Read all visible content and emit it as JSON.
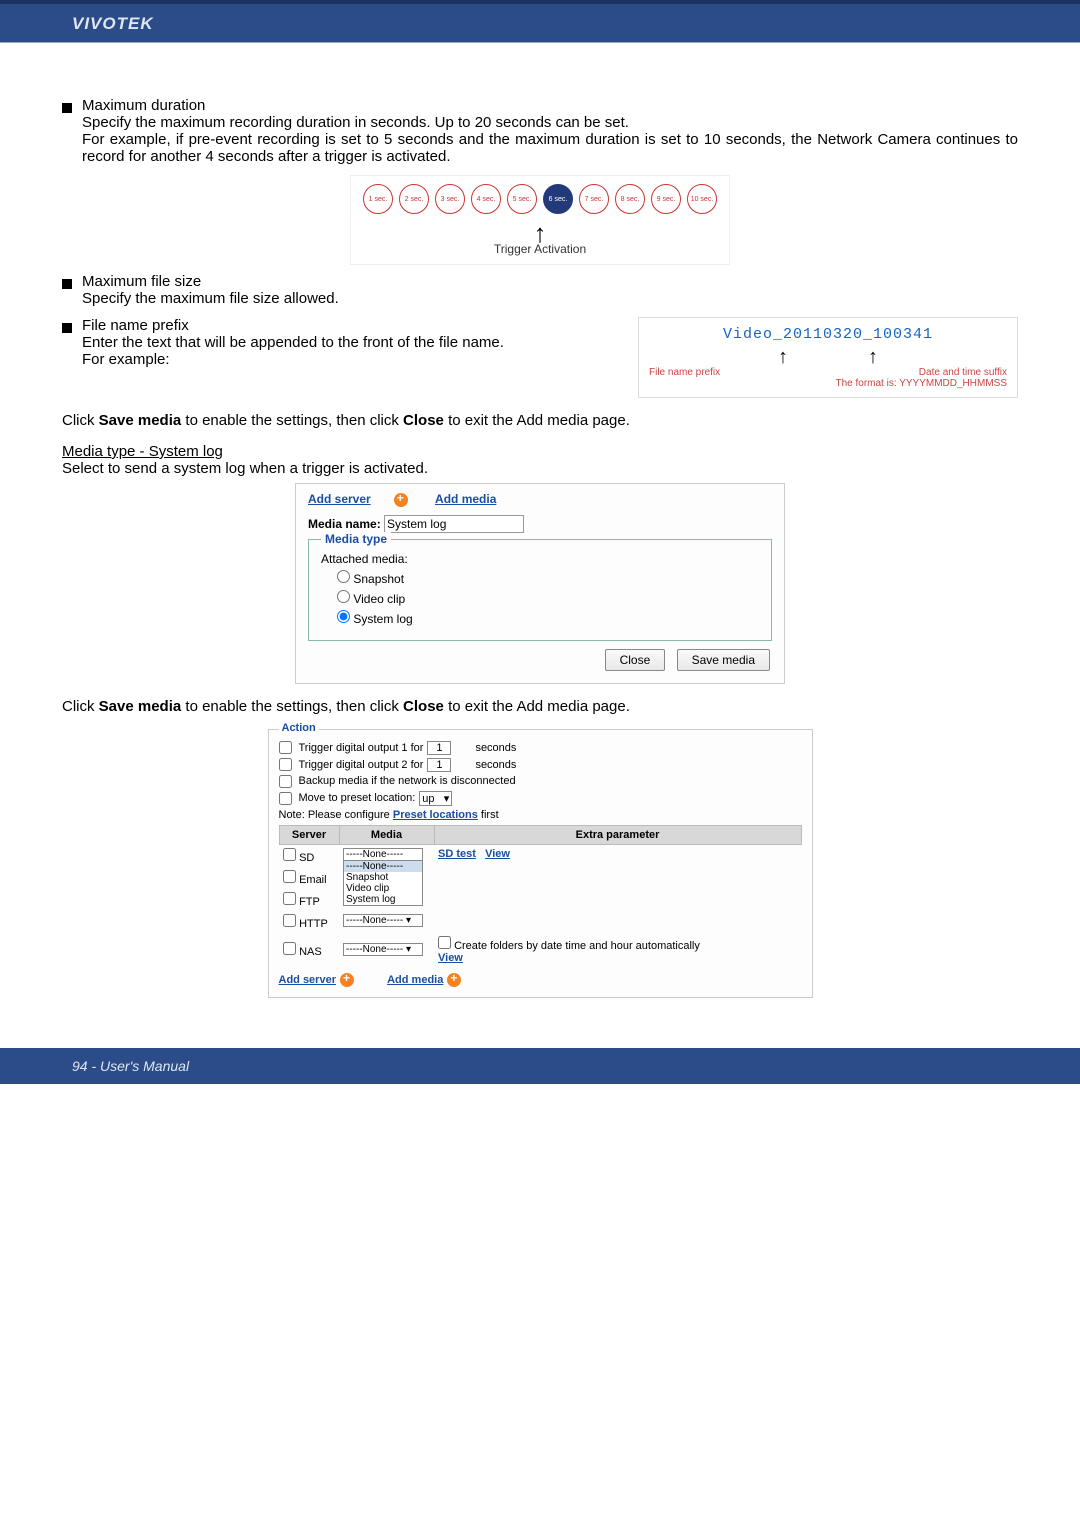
{
  "header": {
    "brand": "VIVOTEK"
  },
  "s1": {
    "title": "Maximum duration",
    "body": "Specify the maximum recording duration in seconds. Up to 20 seconds can be set.",
    "body2": "For example, if pre-event recording is set to 5 seconds and the maximum duration is set to 10 seconds, the Network Camera continues to record for another 4 seconds after a trigger is activated."
  },
  "trigger": {
    "secs": [
      "1 sec.",
      "2 sec.",
      "3 sec.",
      "4 sec.",
      "5 sec.",
      "6 sec.",
      "7 sec.",
      "8 sec.",
      "9 sec.",
      "10 sec."
    ],
    "active_index": 5,
    "label": "Trigger Activation"
  },
  "s2": {
    "title": "Maximum file size",
    "body": "Specify the maximum file size allowed."
  },
  "s3": {
    "title": "File name prefix",
    "body": "Enter the text that will be appended to the front of the file name.",
    "body2": " For example:"
  },
  "prefix": {
    "filename": "Video_20110320_100341",
    "left_label": "File name prefix",
    "right_label": "Date and time suffix",
    "format": "The format is: YYYYMMDD_HHMMSS"
  },
  "para1_a": "Click ",
  "para1_b": "Save media",
  "para1_c": " to enable the settings, then click ",
  "para1_d": "Close",
  "para1_e": " to exit the Add media page.",
  "media_heading": "Media type - System log",
  "media_sub": "Select to send a system log when a trigger is activated.",
  "media_panel": {
    "tab1": "Add server",
    "tab2": "Add media",
    "label": "Media name:",
    "value": "System log",
    "legend": "Media type",
    "attached": "Attached media:",
    "r1": "Snapshot",
    "r2": "Video clip",
    "r3": "System log",
    "close": "Close",
    "save": "Save media"
  },
  "para2_a": "Click ",
  "para2_b": "Save media",
  "para2_c": " to enable the settings, then click ",
  "para2_d": "Close",
  "para2_e": " to exit the Add media page.",
  "action": {
    "legend": "Action",
    "do1_label": "Trigger digital output 1 for",
    "do1_val": "1",
    "do1_sec": "seconds",
    "do2_label": "Trigger digital output 2 for",
    "do2_val": "1",
    "do2_sec": "seconds",
    "backup": "Backup media if the network is disconnected",
    "preset_label": "Move to preset location:",
    "preset_val": "up",
    "note_a": "Note: Please configure ",
    "note_b": "Preset locations",
    "note_c": " first",
    "th_server": "Server",
    "th_media": "Media",
    "th_extra": "Extra parameter",
    "rows": {
      "sd": "SD",
      "email": "Email",
      "ftp": "FTP",
      "http": "HTTP",
      "nas": "NAS"
    },
    "none": "-----None-----",
    "sd_extra1": "SD test",
    "sd_extra2": "View",
    "dropdown": {
      "o1": "-----None-----",
      "o2": "Snapshot",
      "o3": "Video clip",
      "o4": "System log"
    },
    "nas_extra1": "Create folders by date time and hour automatically",
    "nas_extra2": "View",
    "bottom_add_server": "Add server",
    "bottom_add_media": "Add media"
  },
  "footer": "94 - User's Manual"
}
